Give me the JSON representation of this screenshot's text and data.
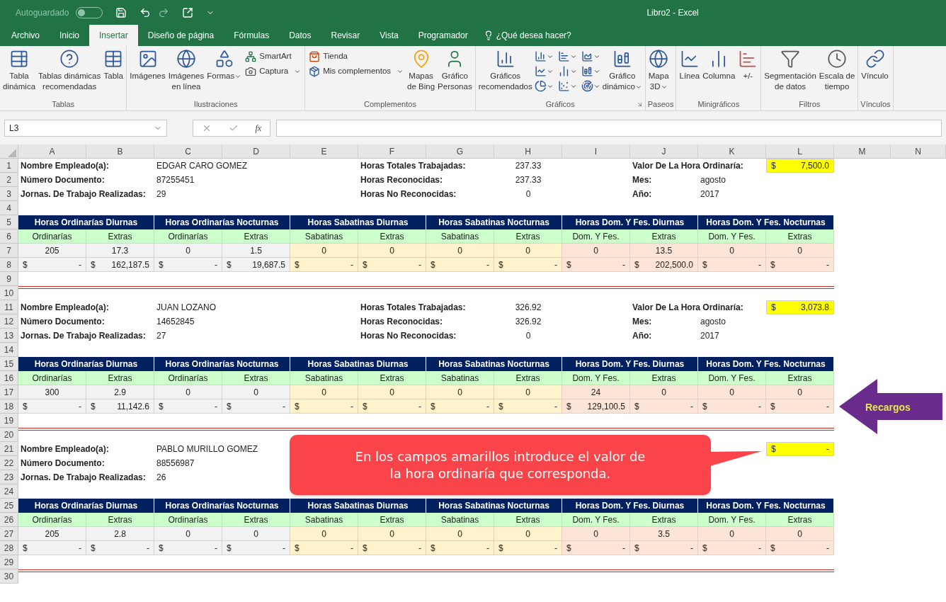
{
  "title_bar": {
    "autosave_label": "Autoguardado",
    "autosave_on": false,
    "title": "Libro2 - Excel"
  },
  "tabs": [
    {
      "label": "Archivo",
      "selected": false
    },
    {
      "label": "Inicio",
      "selected": false
    },
    {
      "label": "Insertar",
      "selected": true
    },
    {
      "label": "Diseño de página",
      "selected": false
    },
    {
      "label": "Fórmulas",
      "selected": false
    },
    {
      "label": "Datos",
      "selected": false
    },
    {
      "label": "Revisar",
      "selected": false
    },
    {
      "label": "Vista",
      "selected": false
    },
    {
      "label": "Programador",
      "selected": false
    }
  ],
  "tell_me": "¿Qué desea hacer?",
  "ribbon": [
    {
      "label": "Tablas",
      "items": [
        {
          "kind": "large",
          "lines": [
            "Tabla",
            "dinámica"
          ],
          "dropdown": false
        },
        {
          "kind": "large",
          "lines": [
            "Tablas dinámicas",
            "recomendadas"
          ],
          "dropdown": false
        },
        {
          "kind": "large",
          "lines": [
            "Tabla"
          ],
          "dropdown": false
        }
      ]
    },
    {
      "label": "Ilustraciones",
      "items": [
        {
          "kind": "large",
          "lines": [
            "Imágenes"
          ],
          "dropdown": false
        },
        {
          "kind": "large",
          "lines": [
            "Imágenes",
            "en línea"
          ],
          "dropdown": false
        },
        {
          "kind": "large",
          "lines": [
            "Formas"
          ],
          "dropdown": true
        },
        {
          "kind": "stack",
          "entries": [
            {
              "label": "SmartArt",
              "dropdown": false
            },
            {
              "label": "Captura",
              "dropdown": true
            }
          ]
        }
      ]
    },
    {
      "label": "Complementos",
      "items": [
        {
          "kind": "stack",
          "entries": [
            {
              "label": "Tienda",
              "dropdown": false
            },
            {
              "label": "Mis complementos",
              "dropdown": true
            }
          ]
        },
        {
          "kind": "large",
          "lines": [
            "Mapas",
            "de Bing"
          ],
          "dropdown": false
        },
        {
          "kind": "large",
          "lines": [
            "Gráfico",
            "Personas"
          ],
          "dropdown": false
        }
      ]
    },
    {
      "label": "Gráficos",
      "launcher": true,
      "items": [
        {
          "kind": "large",
          "lines": [
            "Gráficos",
            "recomendados"
          ],
          "dropdown": false
        },
        {
          "kind": "grid"
        },
        {
          "kind": "large",
          "lines": [
            "Gráfico",
            "dinámico"
          ],
          "dropdown": true
        }
      ]
    },
    {
      "label": "Paseos",
      "items": [
        {
          "kind": "large",
          "lines": [
            "Mapa",
            "3D"
          ],
          "dropdown": true
        }
      ]
    },
    {
      "label": "Minigráficos",
      "items": [
        {
          "kind": "large",
          "lines": [
            "Línea"
          ],
          "dropdown": false
        },
        {
          "kind": "large",
          "lines": [
            "Columna"
          ],
          "dropdown": false
        },
        {
          "kind": "large",
          "lines": [
            "+/-"
          ],
          "dropdown": false
        }
      ]
    },
    {
      "label": "Filtros",
      "items": [
        {
          "kind": "large",
          "lines": [
            "Segmentación",
            "de datos"
          ],
          "dropdown": false
        },
        {
          "kind": "large",
          "lines": [
            "Escala de",
            "tiempo"
          ],
          "dropdown": false
        }
      ]
    },
    {
      "label": "Vínculos",
      "items": [
        {
          "kind": "large",
          "lines": [
            "Vínculo"
          ],
          "dropdown": false
        }
      ]
    }
  ],
  "formula_bar": {
    "name_box": "L3",
    "function_label": "fx"
  },
  "columns": [
    "A",
    "B",
    "C",
    "D",
    "E",
    "F",
    "G",
    "H",
    "I",
    "J",
    "K",
    "L",
    "M",
    "N"
  ],
  "rows": [
    "1",
    "2",
    "3",
    "4",
    "5",
    "6",
    "7",
    "8",
    "9",
    "10",
    "11",
    "12",
    "13",
    "14",
    "15",
    "16",
    "17",
    "18",
    "19",
    "20",
    "21",
    "22",
    "23",
    "24",
    "25",
    "26",
    "27",
    "28",
    "29",
    "30"
  ],
  "blocks": [
    {
      "info": [
        {
          "label": "Nombre Empleado(a):",
          "value": "EDGAR CARO GOMEZ"
        },
        {
          "label": "Número Documento:",
          "value": "87255451"
        },
        {
          "label": "Jornas. De Trabajo Realizadas:",
          "value": "29"
        }
      ],
      "hours": [
        {
          "label": "Horas Totales Trabajadas:",
          "value": "237.33"
        },
        {
          "label": "Horas Reconocidas:",
          "value": "237.33"
        },
        {
          "label": "Horas No Reconocidas:",
          "value": "0"
        }
      ],
      "rate": {
        "label": "Valor De La Hora Ordinaría:",
        "symbol": "$",
        "value": "7,500.0"
      },
      "period": [
        {
          "label": "Mes:",
          "value": "agosto"
        },
        {
          "label": "Año:",
          "value": "2017"
        }
      ],
      "groups": [
        "Horas Ordinarías Diurnas",
        "Horas Ordinarías Nocturnas",
        "Horas Sabatinas Diurnas",
        "Horas Sabatinas Nocturnas",
        "Horas Dom. Y Fes. Diurnas",
        "Horas Dom. Y Fes. Nocturnas"
      ],
      "subheaders": [
        "Ordinarías",
        "Extras",
        "Ordinarías",
        "Extras",
        "Sabatinas",
        "Extras",
        "Sabatinas",
        "Extras",
        "Dom. Y Fes.",
        "Extras",
        "Dom. Y Fes.",
        "Extras"
      ],
      "quantities": [
        "205",
        "17.3",
        "0",
        "1.5",
        "0",
        "0",
        "0",
        "0",
        "0",
        "13.5",
        "0",
        "0"
      ],
      "amounts": [
        {
          "symbol": "$",
          "value": "-"
        },
        {
          "symbol": "$",
          "value": "162,187.5"
        },
        {
          "symbol": "$",
          "value": "-"
        },
        {
          "symbol": "$",
          "value": "19,687.5"
        },
        {
          "symbol": "$",
          "value": "-"
        },
        {
          "symbol": "$",
          "value": "-"
        },
        {
          "symbol": "$",
          "value": "-"
        },
        {
          "symbol": "$",
          "value": "-"
        },
        {
          "symbol": "$",
          "value": "-"
        },
        {
          "symbol": "$",
          "value": "202,500.0"
        },
        {
          "symbol": "$",
          "value": "-"
        },
        {
          "symbol": "$",
          "value": "-"
        }
      ]
    },
    {
      "info": [
        {
          "label": "Nombre Empleado(a):",
          "value": "JUAN LOZANO"
        },
        {
          "label": "Número Documento:",
          "value": "14652845"
        },
        {
          "label": "Jornas. De Trabajo Realizadas:",
          "value": "27"
        }
      ],
      "hours": [
        {
          "label": "Horas Totales Trabajadas:",
          "value": "326.92"
        },
        {
          "label": "Horas Reconocidas:",
          "value": "326.92"
        },
        {
          "label": "Horas No Reconocidas:",
          "value": "0"
        }
      ],
      "rate": {
        "label": "Valor De La Hora Ordinaría:",
        "symbol": "$",
        "value": "3,073.8"
      },
      "period": [
        {
          "label": "Mes:",
          "value": "agosto"
        },
        {
          "label": "Año:",
          "value": "2017"
        }
      ],
      "groups": [
        "Horas Ordinarías Diurnas",
        "Horas Ordinarías Nocturnas",
        "Horas Sabatinas Diurnas",
        "Horas Sabatinas Nocturnas",
        "Horas Dom. Y Fes. Diurnas",
        "Horas Dom. Y Fes. Nocturnas"
      ],
      "subheaders": [
        "Ordinarías",
        "Extras",
        "Ordinarías",
        "Extras",
        "Sabatinas",
        "Extras",
        "Sabatinas",
        "Extras",
        "Dom. Y Fes.",
        "Extras",
        "Dom. Y Fes.",
        "Extras"
      ],
      "quantities": [
        "300",
        "2.9",
        "0",
        "0",
        "0",
        "0",
        "0",
        "0",
        "24",
        "0",
        "0",
        "0"
      ],
      "amounts": [
        {
          "symbol": "$",
          "value": "-"
        },
        {
          "symbol": "$",
          "value": "11,142.6"
        },
        {
          "symbol": "$",
          "value": "-"
        },
        {
          "symbol": "$",
          "value": "-"
        },
        {
          "symbol": "$",
          "value": "-"
        },
        {
          "symbol": "$",
          "value": "-"
        },
        {
          "symbol": "$",
          "value": "-"
        },
        {
          "symbol": "$",
          "value": "-"
        },
        {
          "symbol": "$",
          "value": "129,100.5"
        },
        {
          "symbol": "$",
          "value": "-"
        },
        {
          "symbol": "$",
          "value": "-"
        },
        {
          "symbol": "$",
          "value": "-"
        }
      ]
    },
    {
      "info": [
        {
          "label": "Nombre Empleado(a):",
          "value": "PABLO MURILLO GOMEZ"
        },
        {
          "label": "Número Documento:",
          "value": "88556987"
        },
        {
          "label": "Jornas. De Trabajo Realizadas:",
          "value": "26"
        }
      ],
      "rate": {
        "symbol": "$",
        "value": "-"
      },
      "groups": [
        "Horas Ordinarías Diurnas",
        "Horas Ordinarías Nocturnas",
        "Horas Sabatinas Diurnas",
        "Horas Sabatinas Nocturnas",
        "Horas Dom. Y Fes. Diurnas",
        "Horas Dom. Y Fes. Nocturnas"
      ],
      "subheaders": [
        "Ordinarías",
        "Extras",
        "Ordinarías",
        "Extras",
        "Sabatinas",
        "Extras",
        "Sabatinas",
        "Extras",
        "Dom. Y Fes.",
        "Extras",
        "Dom. Y Fes.",
        "Extras"
      ],
      "quantities": [
        "205",
        "2.8",
        "0",
        "0",
        "0",
        "0",
        "0",
        "0",
        "0",
        "3.5",
        "0",
        "0"
      ],
      "amounts": [
        {
          "symbol": "$",
          "value": "-"
        },
        {
          "symbol": "$",
          "value": "-"
        },
        {
          "symbol": "$",
          "value": "-"
        },
        {
          "symbol": "$",
          "value": "-"
        },
        {
          "symbol": "$",
          "value": "-"
        },
        {
          "symbol": "$",
          "value": "-"
        },
        {
          "symbol": "$",
          "value": "-"
        },
        {
          "symbol": "$",
          "value": "-"
        },
        {
          "symbol": "$",
          "value": "-"
        },
        {
          "symbol": "$",
          "value": "-"
        },
        {
          "symbol": "$",
          "value": "-"
        },
        {
          "symbol": "$",
          "value": "-"
        }
      ]
    }
  ],
  "callout": "En los campos amarillos introduce el valor de la hora ordinaría que corresponda.",
  "arrow_label": "Recargos"
}
